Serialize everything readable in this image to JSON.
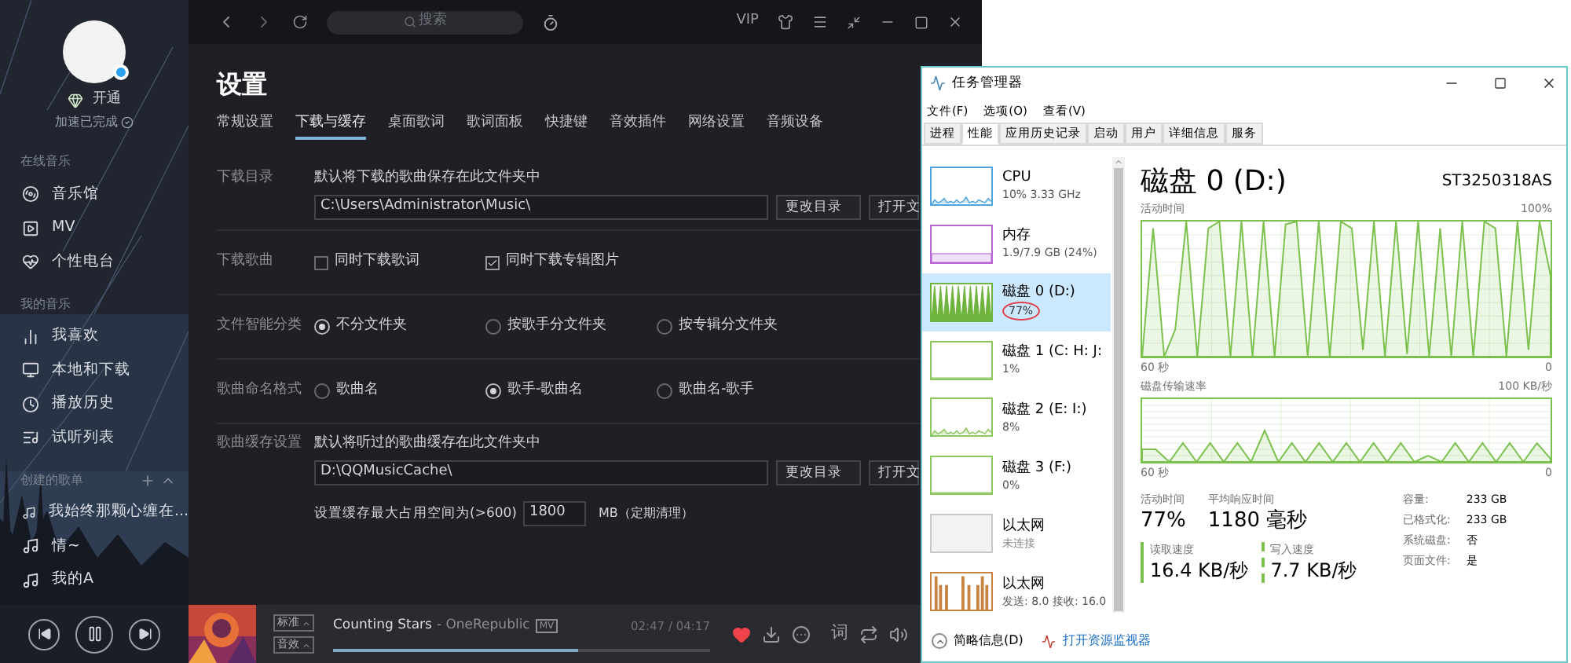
{
  "music": {
    "sidebar": {
      "vip_label": "开通",
      "speed_status": "加速已完成",
      "sections": [
        {
          "title": "在线音乐",
          "items": [
            {
              "label": "音乐馆"
            },
            {
              "label": "MV"
            },
            {
              "label": "个性电台"
            }
          ]
        },
        {
          "title": "我的音乐",
          "items": [
            {
              "label": "我喜欢"
            },
            {
              "label": "本地和下载"
            },
            {
              "label": "播放历史"
            },
            {
              "label": "试听列表"
            }
          ]
        },
        {
          "title": "创建的歌单",
          "items": [
            {
              "label": "我始终那颗心缠在..."
            },
            {
              "label": "情~"
            },
            {
              "label": "我的A"
            }
          ]
        }
      ]
    },
    "topbar": {
      "search_placeholder": "搜索",
      "vip": "VIP"
    },
    "settings": {
      "title": "设置",
      "tabs": [
        {
          "label": "常规设置",
          "selected": false
        },
        {
          "label": "下载与缓存",
          "selected": true
        },
        {
          "label": "桌面歌词",
          "selected": false
        },
        {
          "label": "歌词面板",
          "selected": false
        },
        {
          "label": "快捷键",
          "selected": false
        },
        {
          "label": "音效插件",
          "selected": false
        },
        {
          "label": "网络设置",
          "selected": false
        },
        {
          "label": "音频设备",
          "selected": false
        }
      ],
      "rows": [
        {
          "kind": "folder",
          "label": "下载目录",
          "description": "默认将下载的歌曲保存在此文件夹中",
          "path": "C:\\Users\\Administrator\\Music\\",
          "buttons": [
            "更改目录",
            "打开文"
          ]
        },
        {
          "kind": "checkboxes",
          "label": "下载歌曲",
          "options": [
            {
              "label": "同时下载歌词",
              "checked": false
            },
            {
              "label": "同时下载专辑图片",
              "checked": true
            }
          ]
        },
        {
          "kind": "radios",
          "label": "文件智能分类",
          "options": [
            {
              "label": "不分文件夹",
              "selected": true
            },
            {
              "label": "按歌手分文件夹",
              "selected": false
            },
            {
              "label": "按专辑分文件夹",
              "selected": false
            }
          ]
        },
        {
          "kind": "radios",
          "label": "歌曲命名格式",
          "options": [
            {
              "label": "歌曲名",
              "selected": false
            },
            {
              "label": "歌手-歌曲名",
              "selected": true
            },
            {
              "label": "歌曲名-歌手",
              "selected": false
            }
          ]
        },
        {
          "kind": "folder",
          "label": "歌曲缓存设置",
          "description": "默认将听过的歌曲缓存在此文件夹中",
          "path": "D:\\QQMusicCache\\",
          "buttons": [
            "更改目录",
            "打开文"
          ],
          "size_label": "设置缓存最大占用空间为(>600)",
          "size_value": "1800",
          "size_unit": "MB（定期清理）"
        }
      ]
    },
    "player": {
      "quality": "标准",
      "effect": "音效",
      "song": "Counting Stars",
      "artist": "- OneRepublic",
      "badge": "MV",
      "time": "02:47 / 04:17",
      "progress": {
        "level": 0.65
      },
      "liked": true,
      "lyrics_button": "词"
    }
  },
  "task_manager": {
    "title": "任务管理器",
    "menu": [
      "文件(F)",
      "选项(O)",
      "查看(V)"
    ],
    "tabs": [
      {
        "label": "进程",
        "selected": false
      },
      {
        "label": "性能",
        "selected": true
      },
      {
        "label": "应用历史记录",
        "selected": false
      },
      {
        "label": "启动",
        "selected": false
      },
      {
        "label": "用户",
        "selected": false
      },
      {
        "label": "详细信息",
        "selected": false
      },
      {
        "label": "服务",
        "selected": false
      }
    ],
    "resources": [
      {
        "name": "CPU",
        "detail": "10% 3.33 GHz",
        "color": "#4fa6dc",
        "kind": "sparse",
        "selected": false,
        "annotated": false
      },
      {
        "name": "内存",
        "detail": "1.9/7.9 GB (24%)",
        "color": "#b866d6",
        "kind": "level",
        "selected": false,
        "annotated": false
      },
      {
        "name": "磁盘 0 (D:)",
        "detail": "77%",
        "color": "#6fb43f",
        "kind": "dense",
        "selected": true,
        "annotated": true
      },
      {
        "name": "磁盘 1 (C: H: J:",
        "detail": "1%",
        "color": "#8cc65e",
        "kind": "flat",
        "selected": false,
        "annotated": false
      },
      {
        "name": "磁盘 2 (E: I:)",
        "detail": "8%",
        "color": "#8cc65e",
        "kind": "sparse",
        "selected": false,
        "annotated": false
      },
      {
        "name": "磁盘 3 (F:)",
        "detail": "0%",
        "color": "#8cc65e",
        "kind": "flat",
        "selected": false,
        "annotated": false
      },
      {
        "name": "以太网",
        "detail": "未连接",
        "color": "#c8c8c8",
        "kind": "blank",
        "selected": false,
        "annotated": false
      },
      {
        "name": "以太网",
        "detail": "发送: 8.0 接收: 16.0",
        "color": "#c9833f",
        "kind": "bars",
        "selected": false,
        "annotated": false
      }
    ],
    "footer": {
      "fewer_details": "简略信息(D)",
      "resource_monitor": "打开资源监视器"
    },
    "detail": {
      "title": "磁盘 0 (D:)",
      "model": "ST3250318AS",
      "graphs": [
        {
          "label": "活动时间",
          "max": "100%",
          "start": "60 秒",
          "end": "0",
          "kind": "activity"
        },
        {
          "label": "磁盘传输速率",
          "max": "100 KB/秒",
          "start": "60 秒",
          "end": "0",
          "kind": "transfer"
        }
      ],
      "stats": [
        {
          "label": "活动时间",
          "value": "77%"
        },
        {
          "label": "平均响应时间",
          "value": "1180 毫秒"
        }
      ],
      "speeds": [
        {
          "label": "读取速度",
          "value": "16.4 KB/秒",
          "kind": "read"
        },
        {
          "label": "写入速度",
          "value": "7.7 KB/秒",
          "kind": "write"
        }
      ],
      "properties": [
        {
          "label": "容量:",
          "value": "233 GB"
        },
        {
          "label": "已格式化:",
          "value": "233 GB"
        },
        {
          "label": "系统磁盘:",
          "value": "否"
        },
        {
          "label": "页面文件:",
          "value": "是"
        }
      ]
    }
  }
}
